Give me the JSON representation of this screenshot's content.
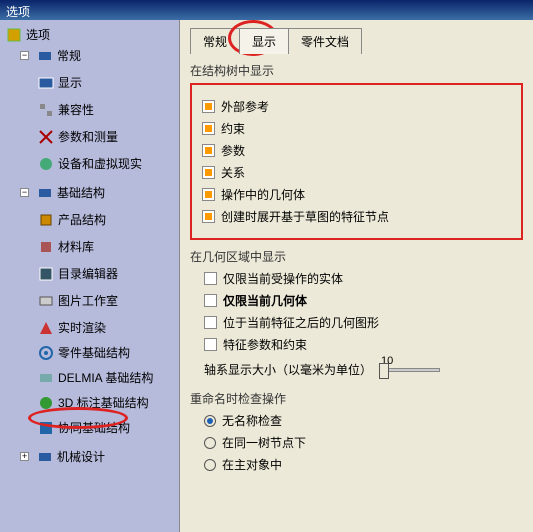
{
  "title": "选项",
  "tree": {
    "root": "选项",
    "general": "常规",
    "general_items": [
      "显示",
      "兼容性",
      "参数和测量",
      "设备和虚拟现实"
    ],
    "infra": "基础结构",
    "infra_items": [
      "产品结构",
      "材料库",
      "目录编辑器",
      "图片工作室",
      "实时渲染",
      "零件基础结构",
      "DELMIA 基础结构",
      "3D 标注基础结构",
      "协同基础结构"
    ],
    "mech": "机械设计"
  },
  "tabs": [
    "常规",
    "显示",
    "零件文档"
  ],
  "group1_label": "在结构树中显示",
  "group1_items": [
    "外部参考",
    "约束",
    "参数",
    "关系",
    "操作中的几何体",
    "创建时展开基于草图的特征节点"
  ],
  "group2_label": "在几何区域中显示",
  "group2_items": [
    "仅限当前受操作的实体",
    "仅限当前几何体",
    "位于当前特征之后的几何图形",
    "特征参数和约束"
  ],
  "axis_label": "轴系显示大小（以毫米为单位）",
  "axis_value": "10",
  "group3_label": "重命名时检查操作",
  "group3_items": [
    "无名称检查",
    "在同一树节点下",
    "在主对象中"
  ]
}
